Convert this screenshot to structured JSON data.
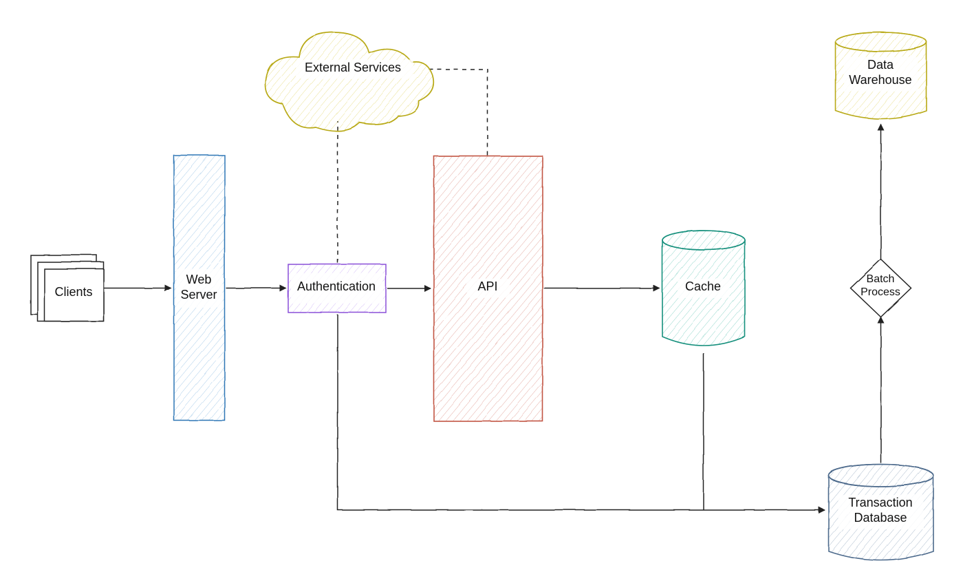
{
  "nodes": {
    "clients": {
      "label": "Clients"
    },
    "web_server": {
      "label": "Web\nServer"
    },
    "authentication": {
      "label": "Authentication"
    },
    "api": {
      "label": "API"
    },
    "cache": {
      "label": "Cache"
    },
    "external": {
      "label": "External Services"
    },
    "batch": {
      "label": "Batch\nProcess"
    },
    "txn_db": {
      "label": "Transaction\nDatabase"
    },
    "warehouse": {
      "label": "Data\nWarehouse"
    }
  },
  "colors": {
    "blue": "#67a6d8",
    "purple": "#8a4fd8",
    "red": "#d06a5a",
    "teal": "#3cb6a2",
    "yellow": "#d9c83a",
    "steel": "#6e8aa8",
    "ink": "#222222"
  },
  "edges": [
    {
      "from": "clients",
      "to": "web_server",
      "style": "solid",
      "arrow": true
    },
    {
      "from": "web_server",
      "to": "authentication",
      "style": "solid",
      "arrow": true
    },
    {
      "from": "authentication",
      "to": "api",
      "style": "solid",
      "arrow": true
    },
    {
      "from": "api",
      "to": "cache",
      "style": "solid",
      "arrow": true
    },
    {
      "from": "authentication",
      "to": "external",
      "style": "dashed",
      "arrow": false
    },
    {
      "from": "api",
      "to": "external",
      "style": "dashed",
      "arrow": false
    },
    {
      "from": "authentication",
      "to": "txn_db",
      "style": "solid",
      "arrow": true
    },
    {
      "from": "cache",
      "to": "txn_db",
      "style": "solid",
      "arrow": false
    },
    {
      "from": "txn_db",
      "to": "batch",
      "style": "solid",
      "arrow": true
    },
    {
      "from": "batch",
      "to": "warehouse",
      "style": "solid",
      "arrow": true
    }
  ],
  "diagram_type": "architecture-flow"
}
